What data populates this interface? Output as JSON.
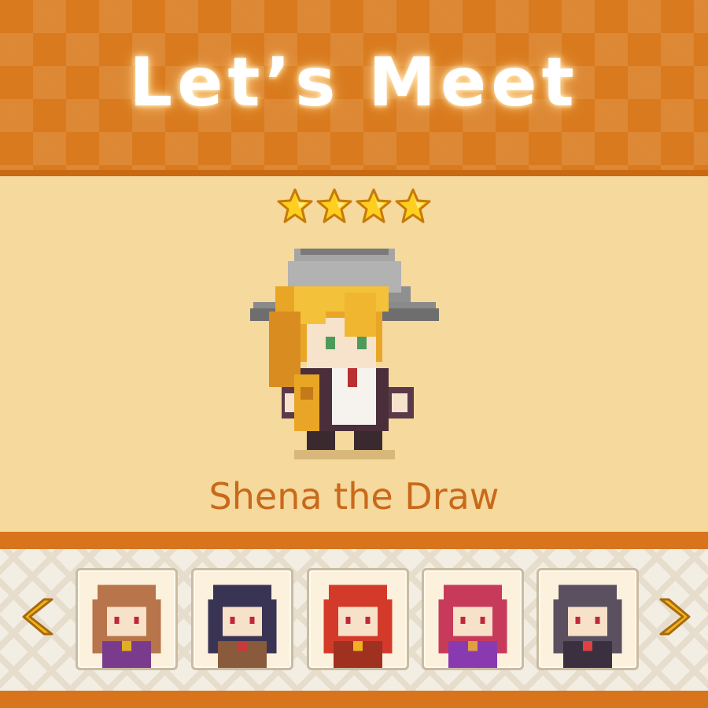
{
  "header": {
    "title": "Let’s Meet"
  },
  "character": {
    "name": "Shena the Draw",
    "stars": 4,
    "star_icon": "star-icon",
    "colors": {
      "hair": "#f2b42a",
      "hat": "#9b9b9b",
      "coat": "#4a2f3a"
    }
  },
  "carousel": {
    "left_arrow_icon": "chevron-left-icon",
    "right_arrow_icon": "chevron-right-icon",
    "portraits": [
      {
        "id": "brown-haired-girl",
        "hair": "#b8744a",
        "outfit": "#7a3b8c",
        "accent": "#e0b020"
      },
      {
        "id": "dark-haired-girl",
        "hair": "#3a3454",
        "outfit": "#8a5a3c",
        "accent": "#c83a3a"
      },
      {
        "id": "red-haired-girl",
        "hair": "#d33a2a",
        "outfit": "#a03020",
        "accent": "#f0b020"
      },
      {
        "id": "magenta-haired-girl",
        "hair": "#c83a5a",
        "outfit": "#8a3ab0",
        "accent": "#e0a040"
      },
      {
        "id": "hooded-warrior",
        "hair": "#5a5060",
        "outfit": "#3a3040",
        "accent": "#e04040"
      }
    ]
  },
  "colors": {
    "accent_orange": "#d8741c",
    "panel_cream": "#f5d99d",
    "name_text": "#c9691a"
  }
}
